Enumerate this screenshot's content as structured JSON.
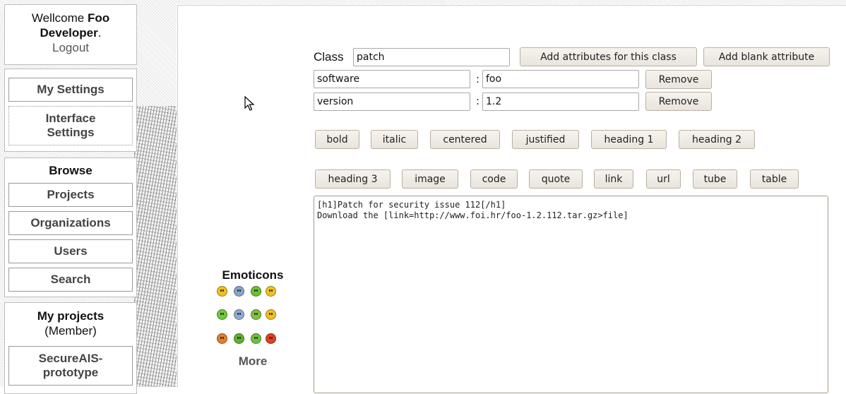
{
  "sidebar": {
    "welcome": {
      "prefix": "Wellcome",
      "name_first": "Foo",
      "name_last": "Developer",
      "suffix": ".",
      "logout": "Logout"
    },
    "settings": {
      "my_settings": "My Settings",
      "interface_settings_line1": "Interface",
      "interface_settings_line2": "Settings"
    },
    "browse": {
      "heading": "Browse",
      "items": [
        "Projects",
        "Organizations",
        "Users",
        "Search"
      ]
    },
    "my_projects": {
      "heading": "My projects",
      "role": "(Member)",
      "project_line1": "SecureAIS-",
      "project_line2": "prototype"
    }
  },
  "form": {
    "class_label": "Class",
    "class_value": "patch",
    "add_attributes_button": "Add attributes for this class",
    "add_blank_attribute_button": "Add blank attribute",
    "attributes": [
      {
        "key": "software",
        "value": "foo",
        "remove": "Remove"
      },
      {
        "key": "version",
        "value": "1.2",
        "remove": "Remove"
      }
    ],
    "colon": ":"
  },
  "toolbar": {
    "row1": [
      "bold",
      "italic",
      "centered",
      "justified",
      "heading 1",
      "heading 2"
    ],
    "row2": [
      "heading 3",
      "image",
      "code",
      "quote",
      "link",
      "url",
      "tube",
      "table"
    ]
  },
  "editor": {
    "text": "[h1]Patch for security issue 112[/h1]\nDownload the [link=http://www.foi.hr/foo-1.2.112.tar.gz>file]"
  },
  "emoticons": {
    "title": "Emoticons",
    "more": "More",
    "icons": [
      {
        "name": "smile",
        "color": "#f0c020"
      },
      {
        "name": "sad-blue",
        "color": "#8aa4c8"
      },
      {
        "name": "tongue-green",
        "color": "#6cc030"
      },
      {
        "name": "grin",
        "color": "#f0c020"
      },
      {
        "name": "smile-green",
        "color": "#70c83c"
      },
      {
        "name": "wide-eyes-blue",
        "color": "#90aad0"
      },
      {
        "name": "confused",
        "color": "#80c040"
      },
      {
        "name": "cool",
        "color": "#f0c020"
      },
      {
        "name": "angry-orange",
        "color": "#e08030"
      },
      {
        "name": "sick-green",
        "color": "#60b030"
      },
      {
        "name": "eyes-green",
        "color": "#70c040"
      },
      {
        "name": "mad-red",
        "color": "#e04020"
      }
    ]
  }
}
